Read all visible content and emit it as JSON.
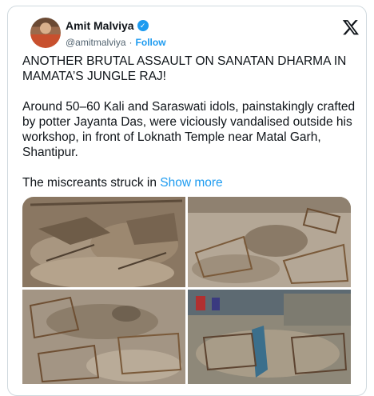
{
  "author": {
    "name": "Amit Malviya",
    "handle": "@amitmalviya",
    "separator": "·",
    "follow_label": "Follow",
    "verified_badge": "verified-check-icon"
  },
  "platform_logo": "x-logo-icon",
  "tweet": {
    "paragraph1": "ANOTHER BRUTAL ASSAULT ON SANATAN DHARMA IN MAMATA’S JUNGLE RAJ!",
    "paragraph2": "Around 50–60 Kali and Saraswati idols, painstakingly crafted by potter Jayanta Das, were viciously vandalised outside his workshop, in front of Loknath Temple near Matal Garh, Shantipur.",
    "paragraph3": "The miscreants struck in",
    "show_more": "Show more"
  },
  "colors": {
    "accent": "#1d9bf0",
    "text": "#0f1419",
    "secondary": "#536471",
    "border": "#cfd9de"
  }
}
